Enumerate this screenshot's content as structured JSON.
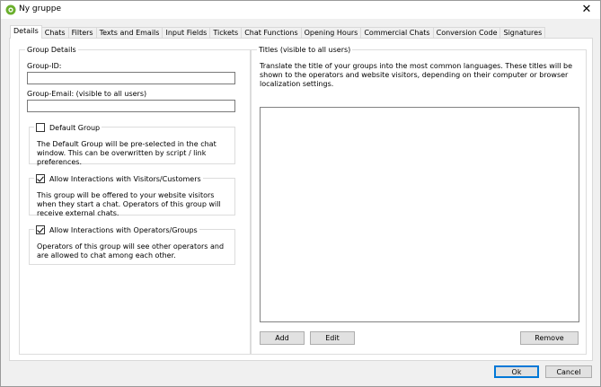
{
  "window": {
    "title": "Ny gruppe",
    "close_glyph": "✕",
    "icon": "app-logo-icon",
    "accent_color": "#6aaf2c"
  },
  "tabs": [
    {
      "label": "Details",
      "active": true
    },
    {
      "label": "Chats",
      "active": false
    },
    {
      "label": "Filters",
      "active": false
    },
    {
      "label": "Texts and Emails",
      "active": false
    },
    {
      "label": "Input Fields",
      "active": false
    },
    {
      "label": "Tickets",
      "active": false
    },
    {
      "label": "Chat Functions",
      "active": false
    },
    {
      "label": "Opening Hours",
      "active": false
    },
    {
      "label": "Commercial Chats",
      "active": false
    },
    {
      "label": "Conversion Code",
      "active": false
    },
    {
      "label": "Signatures",
      "active": false
    }
  ],
  "group_details": {
    "title": "Group Details",
    "group_id_label": "Group-ID:",
    "group_id_value": "",
    "group_email_label": "Group-Email: (visible to all users)",
    "group_email_value": "",
    "options": [
      {
        "label": "Default Group",
        "checked": false,
        "description": "The Default Group will be pre-selected in the chat window. This can be overwritten by script / link preferences."
      },
      {
        "label": "Allow Interactions with Visitors/Customers",
        "checked": true,
        "description": "This group will be offered to your website visitors when they start a chat. Operators of this group will receive external chats."
      },
      {
        "label": "Allow Interactions with Operators/Groups",
        "checked": true,
        "description": "Operators of this group will see other operators and are allowed to chat among each other."
      }
    ]
  },
  "titles": {
    "title": "Titles (visible to all users)",
    "description": "Translate the title of your groups into the most common languages. These titles will be shown to the operators and website visitors, depending on their computer or browser localization settings.",
    "add_label": "Add",
    "edit_label": "Edit",
    "remove_label": "Remove"
  },
  "footer": {
    "ok_label": "Ok",
    "cancel_label": "Cancel"
  }
}
